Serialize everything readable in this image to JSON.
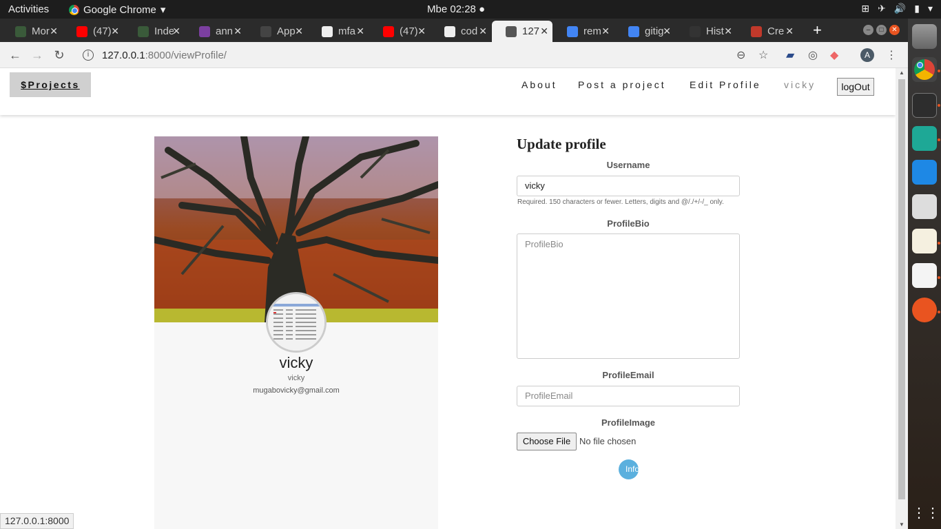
{
  "topbar": {
    "activities": "Activities",
    "app_name": "Google Chrome",
    "clock": "Mbe 02:28 ●"
  },
  "tabs": [
    {
      "title": "Mor",
      "favicon_color": "#3a5a3a",
      "active": false
    },
    {
      "title": "(47)",
      "favicon_color": "#ff0000",
      "active": false
    },
    {
      "title": "Inde",
      "favicon_color": "#3a5a3a",
      "active": false
    },
    {
      "title": "ann",
      "favicon_color": "#7b3fa0",
      "active": false
    },
    {
      "title": "App",
      "favicon_color": "#444444",
      "active": false
    },
    {
      "title": "mfa",
      "favicon_color": "#eeeeee",
      "active": false
    },
    {
      "title": "(47)",
      "favicon_color": "#ff0000",
      "active": false
    },
    {
      "title": "cod",
      "favicon_color": "#eeeeee",
      "active": false
    },
    {
      "title": "127",
      "favicon_color": "#555555",
      "active": true
    },
    {
      "title": "rem",
      "favicon_color": "#4285f4",
      "active": false
    },
    {
      "title": "gitig",
      "favicon_color": "#4285f4",
      "active": false
    },
    {
      "title": "Hist",
      "favicon_color": "#333333",
      "active": false
    },
    {
      "title": "Cre",
      "favicon_color": "#c0392b",
      "active": false
    }
  ],
  "address": {
    "host": "127.0.0.1",
    "path": ":8000/viewProfile/"
  },
  "site": {
    "brand": "$Projects",
    "nav": {
      "about": "About",
      "post": "Post a project",
      "edit": "Edit Profile",
      "user": "vicky"
    },
    "logout": "logOut"
  },
  "profile": {
    "name": "vicky",
    "username": "vicky",
    "email": "mugabovicky@gmail.com"
  },
  "form": {
    "title": "Update profile",
    "username_label": "Username",
    "username_value": "vicky",
    "username_help": "Required. 150 characters or fewer. Letters, digits and @/./+/-/_ only.",
    "bio_label": "ProfileBio",
    "bio_placeholder": "ProfileBio",
    "email_label": "ProfileEmail",
    "email_placeholder": "ProfileEmail",
    "image_label": "ProfileImage",
    "choose_file": "Choose File",
    "no_file": "No file chosen",
    "submit": "Info"
  },
  "statusbar": "127.0.0.1:8000",
  "colors": {
    "accent": "#5bb0de",
    "ubuntu_orange": "#e95420"
  }
}
